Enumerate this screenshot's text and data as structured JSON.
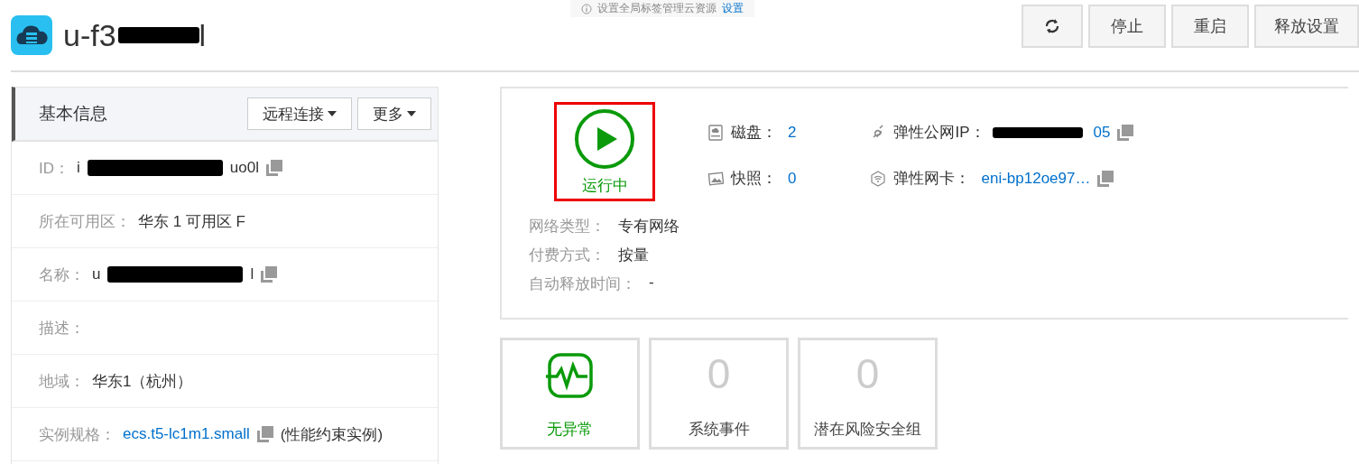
{
  "header": {
    "title_start": "u-f3",
    "title_end": "l",
    "notice": "设置全局标签管理云资源",
    "notice_link": "设置",
    "buttons": [
      {
        "kind": "refresh"
      },
      {
        "kind": "text",
        "label": "停止"
      },
      {
        "kind": "text",
        "label": "重启"
      },
      {
        "kind": "text",
        "label": "释放设置"
      }
    ]
  },
  "basic_info": {
    "title": "基本信息",
    "buttons": [
      "远程连接",
      "更多"
    ],
    "rows": [
      {
        "label": "ID：",
        "value_start": "i",
        "value_end": "uo0l",
        "redacted": true,
        "copy": true,
        "kind": "text"
      },
      {
        "label": "所在可用区：",
        "value_start": "华东 1 可用区 F",
        "redacted": false,
        "copy": false,
        "kind": "text"
      },
      {
        "label": "名称：",
        "value_start": "u",
        "value_end": "l",
        "redacted": true,
        "copy": true,
        "kind": "text"
      },
      {
        "label": "描述：",
        "redacted": false,
        "copy": false
      },
      {
        "label": "地域：",
        "value_start": "华东1（杭州）",
        "redacted": false,
        "copy": false,
        "kind": "text"
      },
      {
        "label": "实例规格：",
        "value_start": "ecs.t5-lc1m1.small",
        "redacted": false,
        "copy": true,
        "kind": "link",
        "note": "(性能约束实例)"
      }
    ]
  },
  "status": {
    "label": "运行中",
    "running": true
  },
  "resources": [
    {
      "label": "磁盘：",
      "value": "2"
    },
    {
      "label": "快照：",
      "value": "0"
    }
  ],
  "network": [
    {
      "label": "弹性公网IP：",
      "value": "05",
      "redacted": true
    },
    {
      "label": "弹性网卡：",
      "value": "eni-bp12oe97…",
      "redacted": false
    }
  ],
  "details": [
    {
      "label": "网络类型：",
      "value": "专有网络"
    },
    {
      "label": "付费方式：",
      "value": "按量"
    },
    {
      "label": "自动释放时间：",
      "value": "-"
    }
  ],
  "tiles": [
    {
      "kind": "health",
      "label": "无异常"
    },
    {
      "kind": "count",
      "value": "0",
      "label": "系统事件"
    },
    {
      "kind": "count",
      "value": "0",
      "label": "潜在风险安全组"
    }
  ]
}
